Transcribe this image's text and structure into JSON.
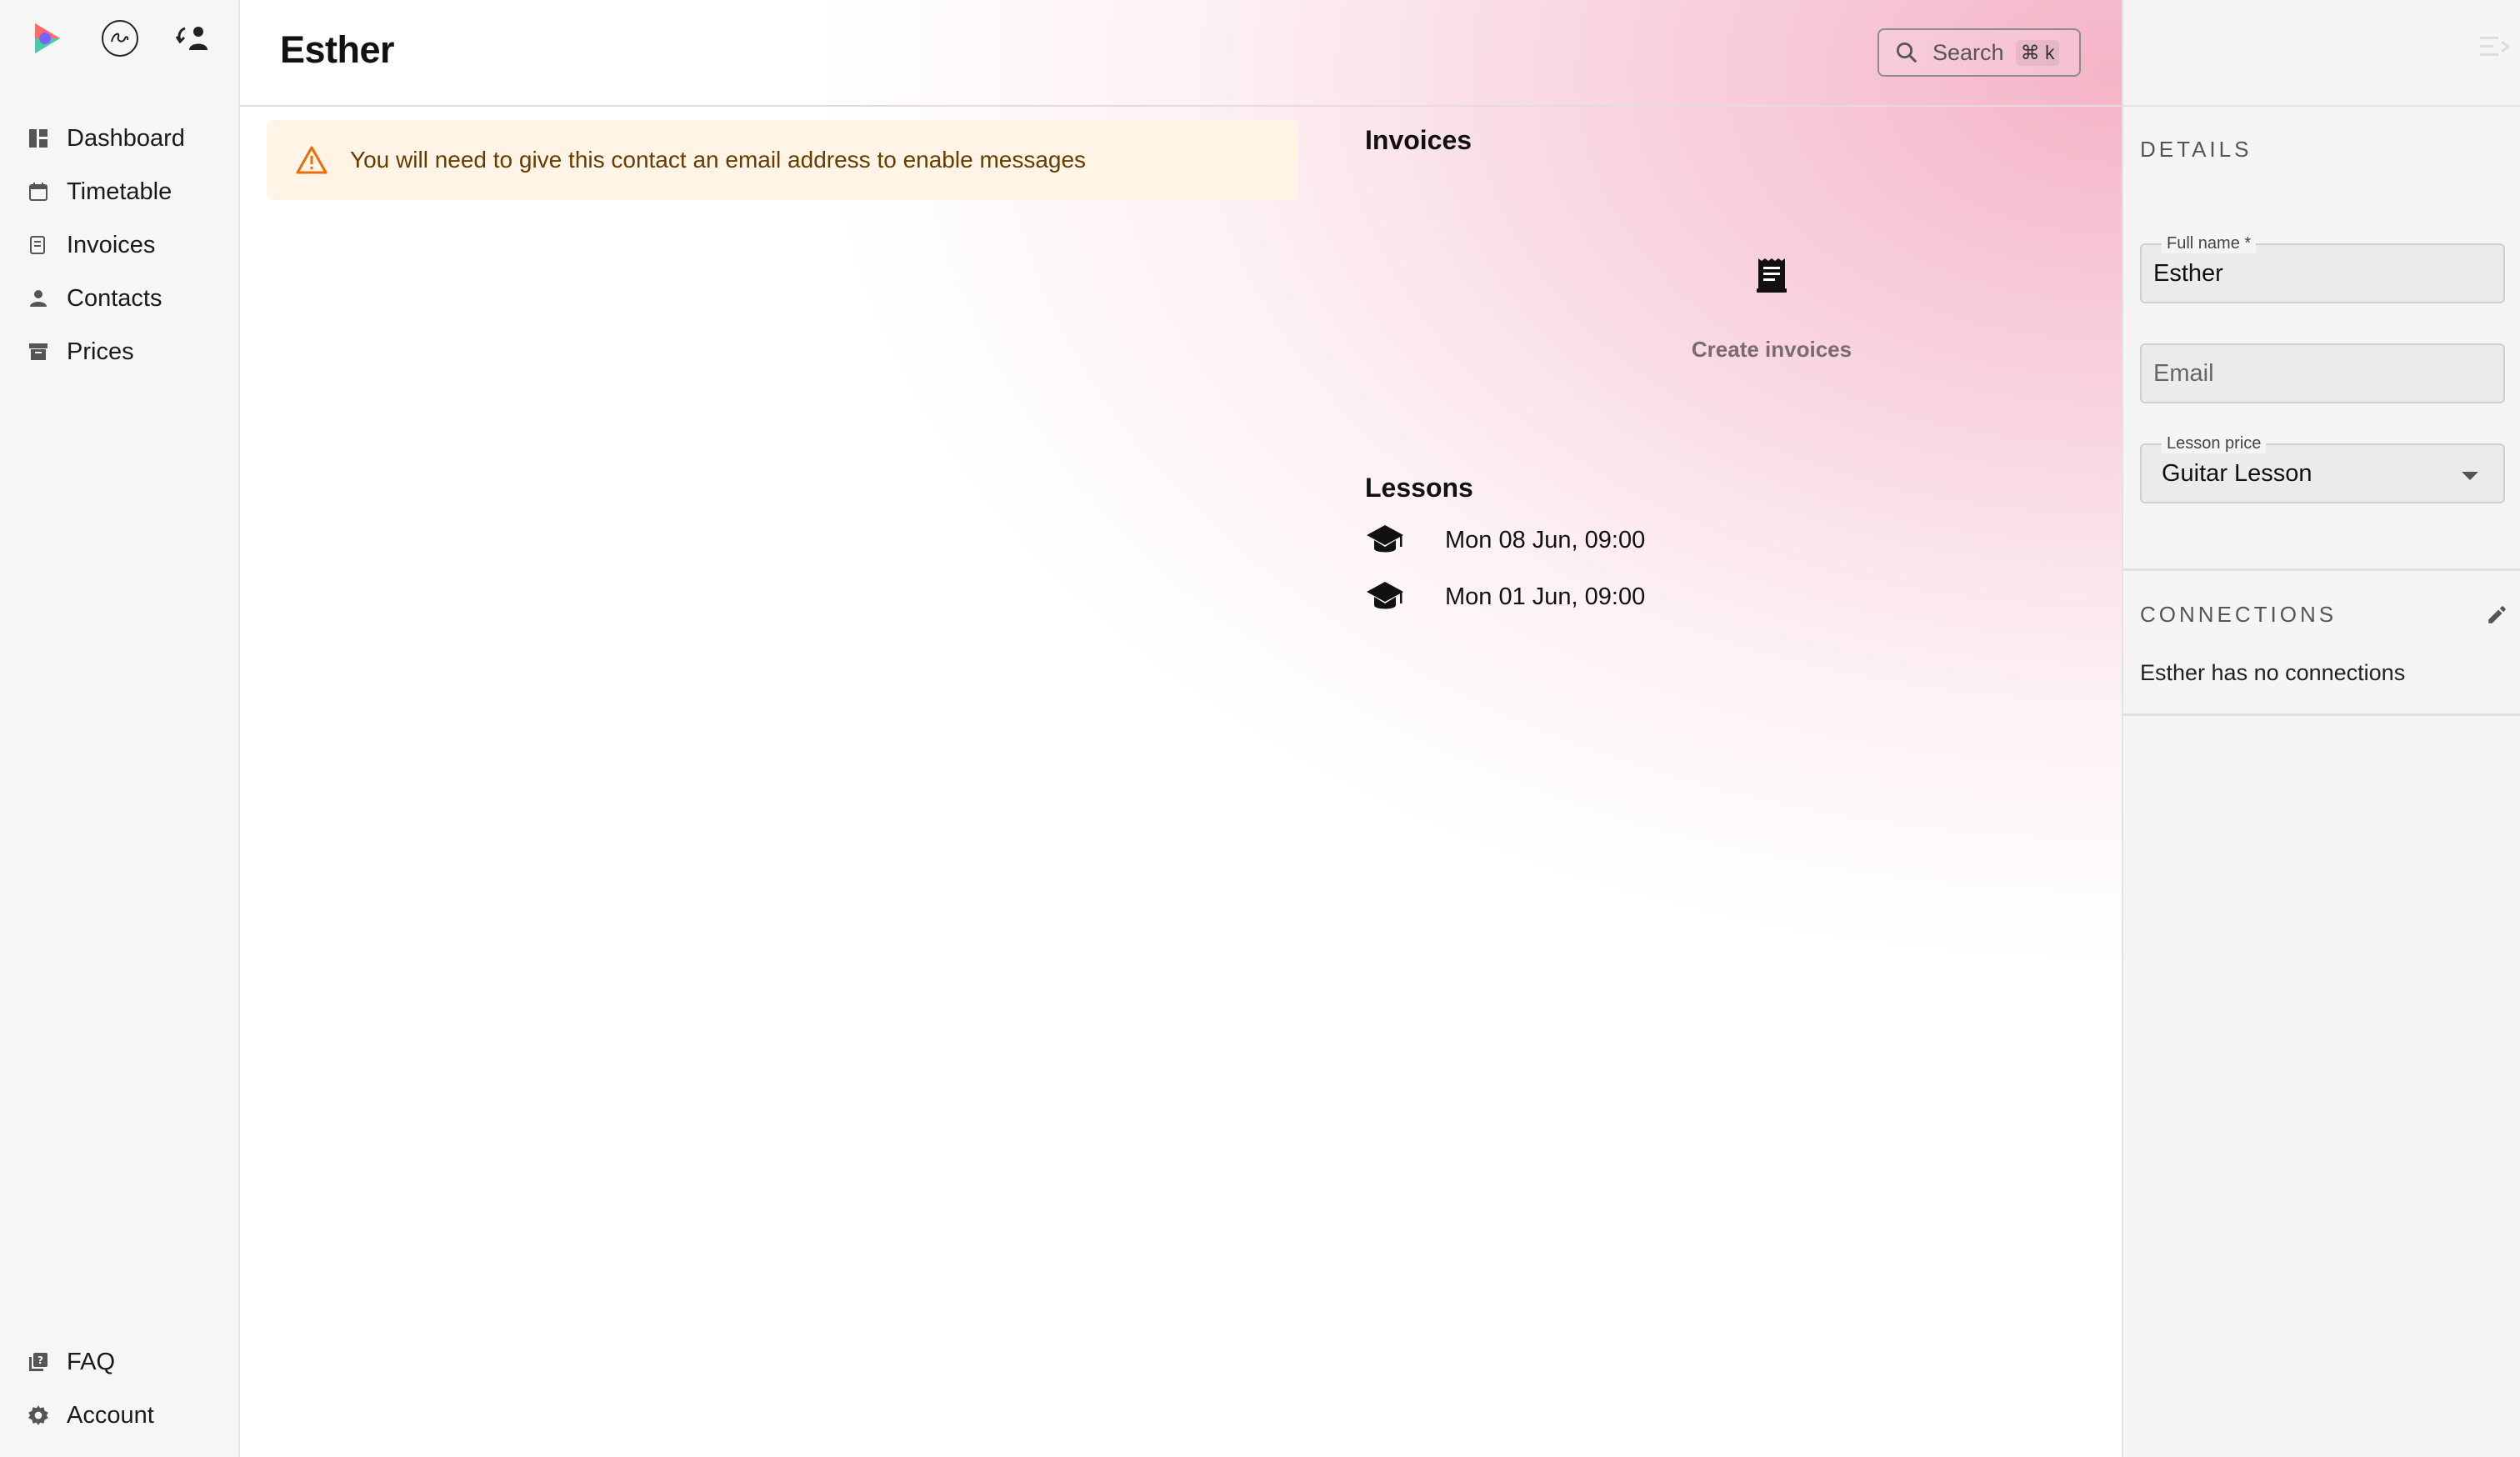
{
  "sidebar": {
    "logos": [
      {
        "name": "app-logo-icon"
      },
      {
        "name": "seni-logo-icon"
      },
      {
        "name": "switch-account-icon"
      }
    ],
    "items": [
      {
        "label": "Dashboard",
        "icon": "dashboard-icon"
      },
      {
        "label": "Timetable",
        "icon": "calendar-icon"
      },
      {
        "label": "Invoices",
        "icon": "invoice-icon"
      },
      {
        "label": "Contacts",
        "icon": "person-icon"
      },
      {
        "label": "Prices",
        "icon": "archive-icon"
      }
    ],
    "bottom_items": [
      {
        "label": "FAQ",
        "icon": "faq-icon"
      },
      {
        "label": "Account",
        "icon": "gear-icon"
      }
    ]
  },
  "header": {
    "title": "Esther",
    "search_label": "Search",
    "search_shortcut": "⌘ k"
  },
  "alert": {
    "text": "You will need to give this contact an email address to enable messages",
    "icon": "warning-icon"
  },
  "invoices": {
    "title": "Invoices",
    "empty_label": "Create invoices",
    "empty_icon": "receipt-icon"
  },
  "lessons": {
    "title": "Lessons",
    "items": [
      {
        "label": "Mon 08 Jun, 09:00",
        "icon": "graduation-cap-icon"
      },
      {
        "label": "Mon 01 Jun, 09:00",
        "icon": "graduation-cap-icon"
      }
    ]
  },
  "details": {
    "heading": "DETAILS",
    "full_name_label": "Full name *",
    "full_name_value": "Esther",
    "email_placeholder": "Email",
    "lesson_price_label": "Lesson price",
    "lesson_price_value": "Guitar Lesson"
  },
  "connections": {
    "heading": "CONNECTIONS",
    "empty_text": "Esther has no connections"
  },
  "colors": {
    "accent_pink": "#f4b0c4",
    "alert_bg": "#fff4e5",
    "alert_text": "#663c00",
    "warning_icon": "#ed6c02"
  }
}
